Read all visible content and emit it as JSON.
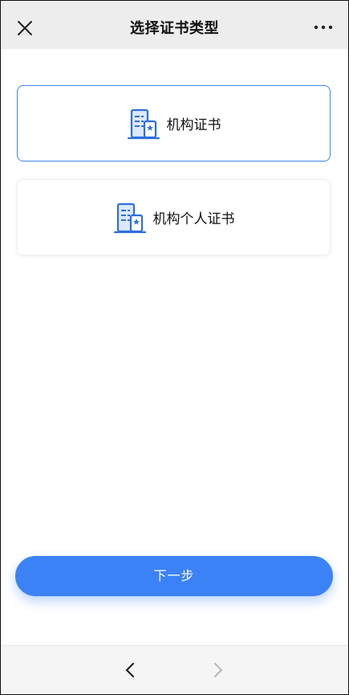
{
  "header": {
    "title": "选择证书类型",
    "close_icon": "close-icon",
    "more_icon": "more-dots-icon"
  },
  "options": [
    {
      "label": "机构证书",
      "icon": "building-icon",
      "selected": true
    },
    {
      "label": "机构个人证书",
      "icon": "building-icon",
      "selected": false
    }
  ],
  "next_button": {
    "label": "下一步"
  },
  "footer": {
    "back_icon": "chevron-left-icon",
    "forward_icon": "chevron-right-icon",
    "forward_disabled": true
  },
  "colors": {
    "accent": "#3b82f6",
    "selected_border": "#3f86f0",
    "header_bg": "#ededed",
    "footer_bg": "#f5f5f5"
  }
}
